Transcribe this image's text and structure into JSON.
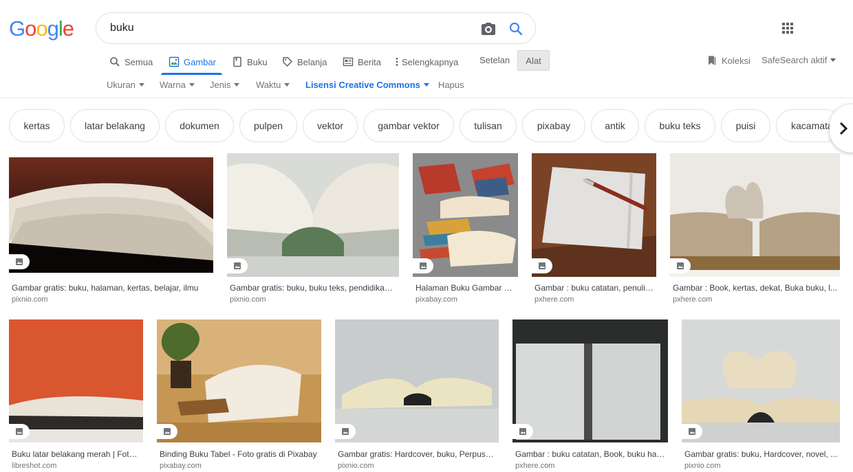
{
  "logo": {
    "letters": [
      "G",
      "o",
      "o",
      "g",
      "l",
      "e"
    ],
    "colors": [
      "#4285f4",
      "#ea4335",
      "#fbbc05",
      "#4285f4",
      "#34a853",
      "#ea4335"
    ]
  },
  "search": {
    "query": "buku"
  },
  "tabs": [
    {
      "label": "Semua",
      "icon": "search-icon"
    },
    {
      "label": "Gambar",
      "icon": "image-icon",
      "active": true
    },
    {
      "label": "Buku",
      "icon": "book-icon"
    },
    {
      "label": "Belanja",
      "icon": "tag-icon"
    },
    {
      "label": "Berita",
      "icon": "news-icon"
    },
    {
      "label": "Selengkapnya",
      "icon": "more-vert-icon"
    }
  ],
  "settings_label": "Setelan",
  "tools_label": "Alat",
  "collections_label": "Koleksi",
  "safesearch_label": "SafeSearch aktif",
  "tools": [
    {
      "label": "Ukuran"
    },
    {
      "label": "Warna"
    },
    {
      "label": "Jenis"
    },
    {
      "label": "Waktu"
    },
    {
      "label": "Lisensi Creative Commons"
    },
    {
      "label": "Hapus"
    }
  ],
  "chips": [
    "kertas",
    "latar belakang",
    "dokumen",
    "pulpen",
    "vektor",
    "gambar vektor",
    "tulisan",
    "pixabay",
    "antik",
    "buku teks",
    "puisi",
    "kacamata"
  ],
  "results": [
    {
      "title": "Gambar gratis: buku, halaman, kertas, belajar, ilmu",
      "source": "pixnio.com"
    },
    {
      "title": "Gambar gratis: buku, buku teks, pendidikan, ...",
      "source": "pixnio.com"
    },
    {
      "title": "Halaman Buku Gambar vektor ...",
      "source": "pixabay.com"
    },
    {
      "title": "Gambar : buku catatan, penulisan ...",
      "source": "pxhere.com"
    },
    {
      "title": "Gambar : Book, kertas, dekat, Buka buku, l...",
      "source": "pxhere.com"
    },
    {
      "title": "Buku latar belakang merah | Foto ...",
      "source": "libreshot.com"
    },
    {
      "title": "Binding Buku Tabel - Foto gratis di Pixabay",
      "source": "pixabay.com"
    },
    {
      "title": "Gambar gratis: Hardcover, buku, Perpustakaan",
      "source": "pixnio.com"
    },
    {
      "title": "Gambar : buku catatan, Book, buku harian",
      "source": "pxhere.com"
    },
    {
      "title": "Gambar gratis: buku, Hardcover, novel, ...",
      "source": "pixnio.com"
    }
  ],
  "colors": {
    "accent": "#1a73e8",
    "text": "#202124",
    "muted": "#70757a"
  }
}
